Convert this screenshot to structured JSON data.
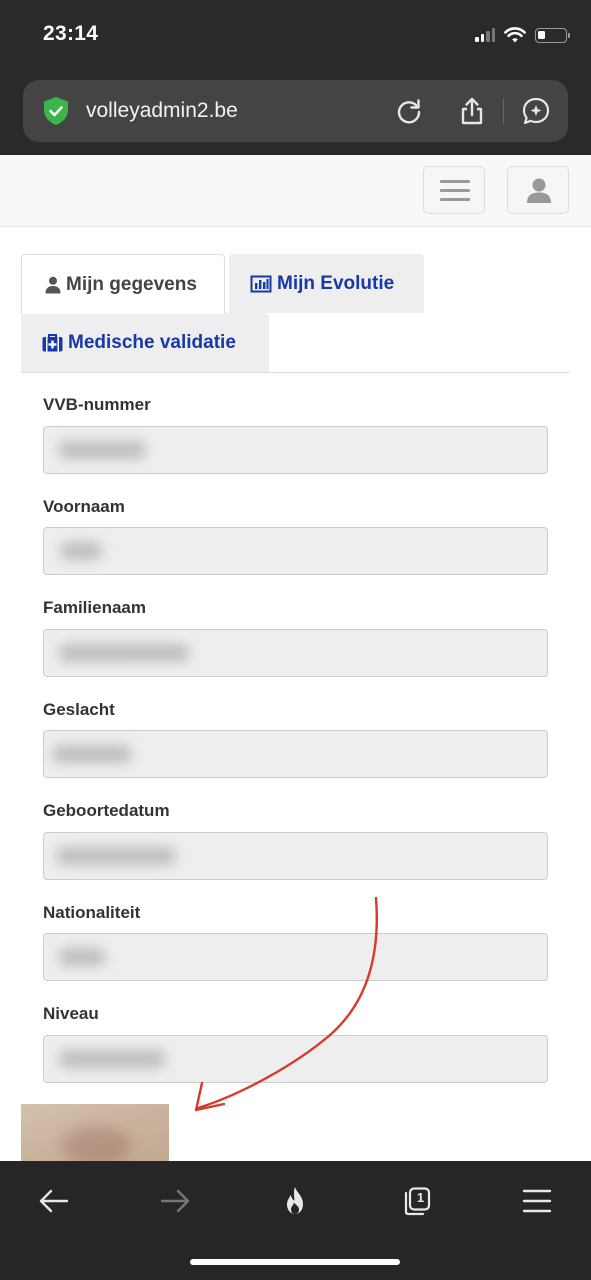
{
  "status_bar": {
    "time": "23:14"
  },
  "browser": {
    "url": "volleyadmin2.be",
    "icons": {
      "security": "shield-check-icon",
      "reload": "reload-icon",
      "share": "share-icon",
      "assistant": "ai-chat-icon"
    },
    "toolbar": {
      "back": "back-arrow-icon",
      "forward": "forward-arrow-icon",
      "flame": "flame-icon",
      "tab_count": "1",
      "menu": "menu-icon"
    },
    "shield_color": "#3bb44a"
  },
  "navbar": {
    "menu_icon": "hamburger-icon",
    "user_icon": "user-icon"
  },
  "tabs": {
    "mijn_gegevens": "Mijn gegevens",
    "mijn_evolutie": "Mijn Evolutie",
    "medische_validatie": "Medische validatie"
  },
  "form": {
    "fields": [
      {
        "label": "VVB-nummer"
      },
      {
        "label": "Voornaam"
      },
      {
        "label": "Familienaam"
      },
      {
        "label": "Geslacht"
      },
      {
        "label": "Geboortedatum"
      },
      {
        "label": "Nationaliteit"
      },
      {
        "label": "Niveau"
      }
    ]
  },
  "colors": {
    "link": "#1738a8",
    "annotation_arrow": "#d63a2a",
    "browser_chrome": "#2a2a2a"
  }
}
